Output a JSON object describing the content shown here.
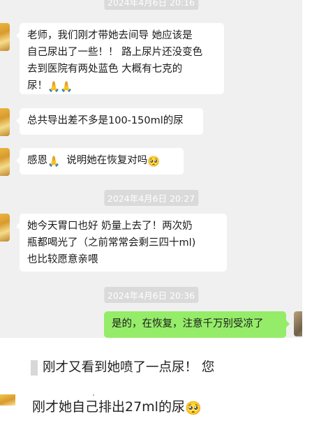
{
  "timestamps": [
    "2024年4月6日 20:16",
    "2024年4月6日 20:27",
    "2024年4月6日 20:36"
  ],
  "messages": [
    {
      "side": "left",
      "lines": [
        "老师，我们刚才带她去间导 她应该是",
        "自己尿出了一些！！ 路上尿片还没变色",
        "去到医院有两处蓝色 大概有七克的",
        "尿！"
      ],
      "emoji_after": "🙏🙏"
    },
    {
      "side": "left",
      "lines": [
        "总共导出差不多是100-150ml的尿"
      ]
    },
    {
      "side": "left",
      "text_a": "感恩",
      "emoji_a": "🙏",
      "text_b": "说明她在恢复对吗",
      "emoji_b": "🥺"
    },
    {
      "side": "left",
      "lines": [
        "她今天胃口也好 奶量上去了！两次奶",
        "瓶都喝光了（之前常常会剩三四十ml)",
        "也比较愿意亲喂"
      ]
    },
    {
      "side": "right",
      "lines": [
        "是的，在恢复，注意千万别受凉了"
      ]
    }
  ],
  "lower": {
    "cut_message": "刚才又看到她喷了一点尿！ 您",
    "final_message": "刚才她自己排出27ml的尿",
    "final_emoji": "🥺"
  }
}
